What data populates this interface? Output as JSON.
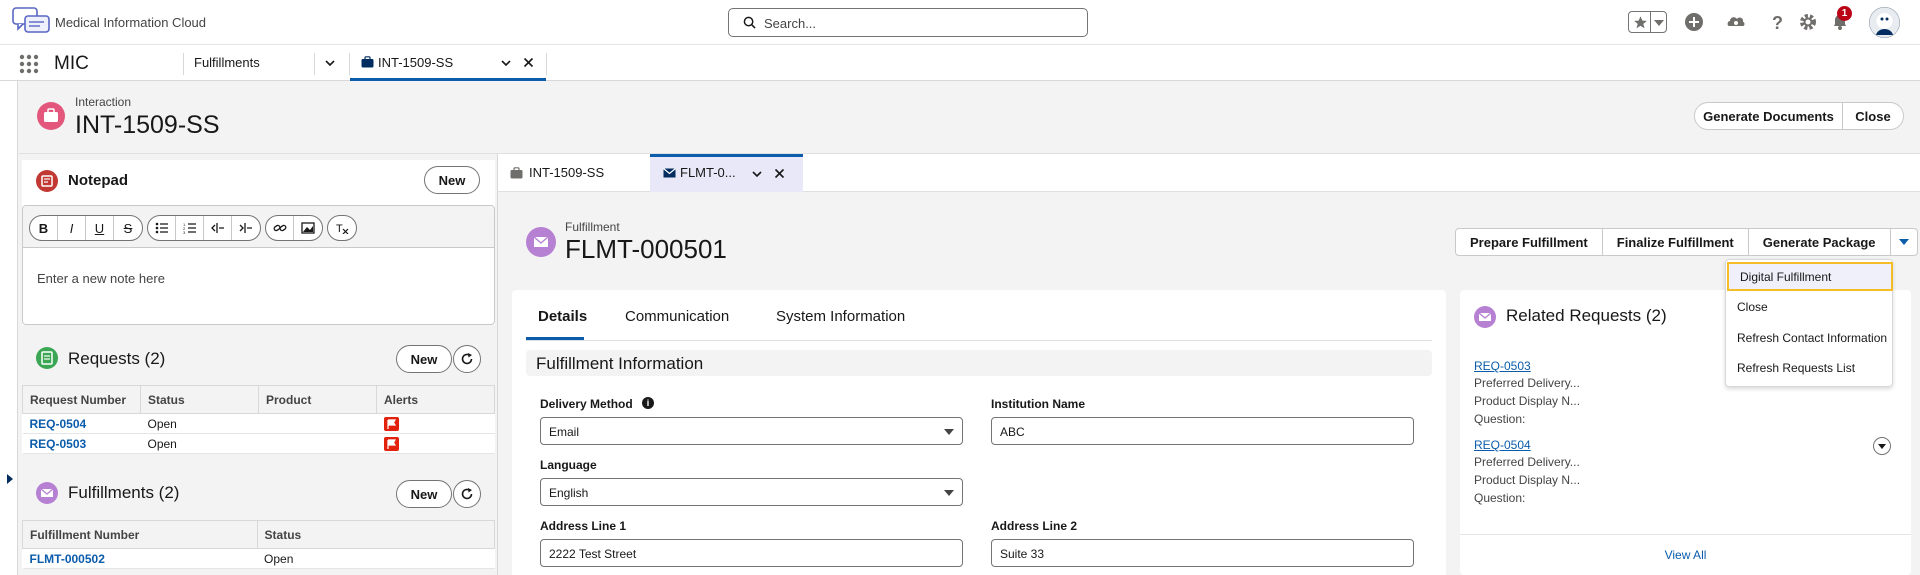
{
  "global_header": {
    "logo_text": "Medical Information Cloud",
    "search_placeholder": "Search...",
    "notification_count": "1"
  },
  "nav": {
    "app_name": "MIC",
    "tab_fulfillments": "Fulfillments",
    "tab_active": "INT-1509-SS"
  },
  "page_header": {
    "kind": "Interaction",
    "title": "INT-1509-SS",
    "btn_generate_documents": "Generate Documents",
    "btn_close": "Close"
  },
  "notepad": {
    "title": "Notepad",
    "new_label": "New",
    "placeholder": "Enter a new note here"
  },
  "requests": {
    "title": "Requests (2)",
    "new_label": "New",
    "columns": [
      "Request Number",
      "Status",
      "Product",
      "Alerts"
    ],
    "rows": [
      {
        "number": "REQ-0504",
        "status": "Open",
        "product": ""
      },
      {
        "number": "REQ-0503",
        "status": "Open",
        "product": ""
      }
    ]
  },
  "fulfillments": {
    "title": "Fulfillments (2)",
    "new_label": "New",
    "columns": [
      "Fulfillment Number",
      "Status"
    ],
    "rows": [
      {
        "number": "FLMT-000502",
        "status": "Open"
      }
    ]
  },
  "subtabs": {
    "tab1": "INT-1509-SS",
    "tab2": "FLMT-0..."
  },
  "record": {
    "kind": "Fulfillment",
    "title": "FLMT-000501",
    "actions": [
      "Prepare Fulfillment",
      "Finalize Fulfillment",
      "Generate Package"
    ]
  },
  "details": {
    "tabs": [
      "Details",
      "Communication",
      "System Information"
    ],
    "section_title": "Fulfillment Information",
    "fields": {
      "delivery_method_label": "Delivery Method",
      "delivery_method_value": "Email",
      "institution_label": "Institution Name",
      "institution_value": "ABC",
      "language_label": "Language",
      "language_value": "English",
      "address1_label": "Address Line 1",
      "address1_value": "2222 Test Street",
      "address2_label": "Address Line 2",
      "address2_value": "Suite 33"
    }
  },
  "related": {
    "title": "Related Requests (2)",
    "items": [
      {
        "link": "REQ-0503",
        "line1": "Preferred Delivery...",
        "line2": "Product Display N...",
        "line3": "Question:"
      },
      {
        "link": "REQ-0504",
        "line1": "Preferred Delivery...",
        "line2": "Product Display N...",
        "line3": "Question:"
      }
    ],
    "view_all": "View All"
  },
  "dropdown_menu": {
    "items": [
      "Digital Fulfillment",
      "Close",
      "Refresh Contact Information",
      "Refresh Requests List"
    ]
  },
  "colors": {
    "brand_blue": "#0b5cab",
    "interaction_pink": "#e3577c",
    "fulfillment_purple": "#b781d3",
    "requests_green": "#3ba755",
    "notepad_red": "#c23934",
    "focus_yellow": "#f4bc25"
  }
}
